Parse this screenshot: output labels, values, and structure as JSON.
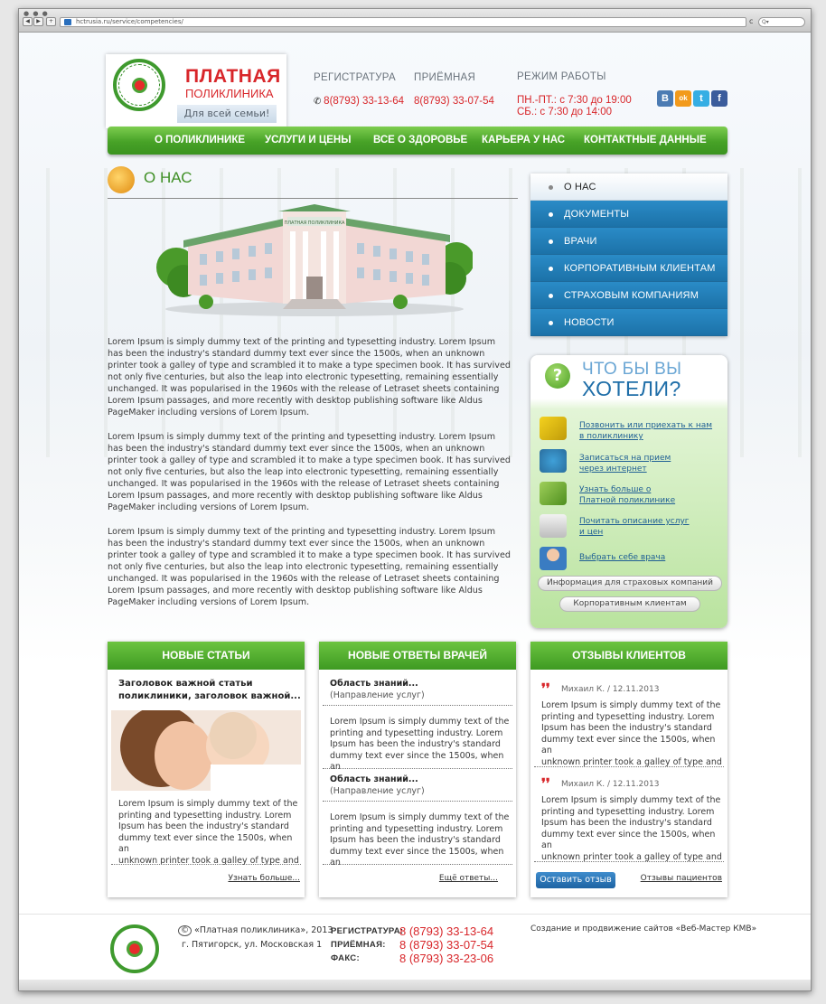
{
  "browser": {
    "url": "hctrusia.ru/service/competencies/"
  },
  "header": {
    "logo_title": "ПЛАТНАЯ",
    "logo_subtitle": "ПОЛИКЛИНИКА",
    "slogan": "Для всей семьи!",
    "reg_label": "РЕГИСТРАТУРА",
    "reg_phone": "8(8793) 33-13-64",
    "reception_label": "ПРИЁМНАЯ",
    "reception_phone": "8(8793) 33-07-54",
    "hours_label": "РЕЖИМ РАБОТЫ",
    "hours_weekday": "ПН.-ПТ.: с 7:30 до 19:00",
    "hours_saturday": "СБ.: с 7:30 до 14:00",
    "social": [
      "В",
      "ok",
      "t",
      "f"
    ]
  },
  "menu": [
    "О ПОЛИКЛИНИКЕ",
    "УСЛУГИ И ЦЕНЫ",
    "ВСЕ О ЗДОРОВЬЕ",
    "КАРЬЕРА У НАС",
    "КОНТАКТНЫЕ ДАННЫЕ"
  ],
  "main": {
    "title": "О НАС",
    "building_sign": "ПЛАТНАЯ ПОЛИКЛИНИКА",
    "paragraphs": [
      "Lorem Ipsum is simply dummy text of the printing and typesetting industry. Lorem Ipsum has been the industry's standard dummy text ever since the 1500s, when an unknown printer took a galley of type and scrambled it to make a type specimen book. It has survived not only five centuries, but also the leap into electronic typesetting, remaining essentially unchanged. It was popularised in the 1960s with the release of Letraset sheets containing Lorem Ipsum passages, and more recently with desktop publishing software like Aldus PageMaker including versions of Lorem Ipsum.",
      "Lorem Ipsum is simply dummy text of the printing and typesetting industry. Lorem Ipsum has been the industry's standard dummy text ever since the 1500s, when an unknown printer took a galley of type and scrambled it to make a type specimen book. It has survived not only five centuries, but also the leap into electronic typesetting, remaining essentially unchanged. It was popularised in the 1960s with the release of Letraset sheets containing Lorem Ipsum passages, and more recently with desktop publishing software like Aldus PageMaker including versions of Lorem Ipsum.",
      "Lorem Ipsum is simply dummy text of the printing and typesetting industry. Lorem Ipsum has been the industry's standard dummy text ever since the 1500s, when an unknown printer took a galley of type and scrambled it to make a type specimen book. It has survived not only five centuries, but also the leap into electronic typesetting, remaining essentially unchanged. It was popularised in the 1960s with the release of Letraset sheets containing Lorem Ipsum passages, and more recently with desktop publishing software like Aldus PageMaker including versions of Lorem Ipsum."
    ]
  },
  "sidebar": {
    "items": [
      "О НАС",
      "ДОКУМЕНТЫ",
      "ВРАЧИ",
      "КОРПОРАТИВНЫМ КЛИЕНТАМ",
      "СТРАХОВЫМ КОМПАНИЯМ",
      "НОВОСТИ"
    ]
  },
  "want": {
    "title1": "ЧТО БЫ ВЫ",
    "title2": "ХОТЕЛИ?",
    "links": [
      [
        "Позвонить или приехать к нам",
        "в поликлинику"
      ],
      [
        "Записаться на прием",
        "через интернет"
      ],
      [
        "Узнать больше о",
        "Платной поликлинике"
      ],
      [
        "Почитать описание услуг",
        "и цен"
      ],
      [
        "Выбрать себе врача"
      ]
    ],
    "btn_insurance": "Информация для страховых компаний",
    "btn_corporate": "Корпоративным клиентам"
  },
  "articles": {
    "title": "НОВЫЕ СТАТЬИ",
    "headline_1": "Заголовок важной статьи",
    "headline_2": "поликлиники, заголовок важной...",
    "text": [
      "Lorem Ipsum is simply dummy text of the",
      "printing and typesetting industry. Lorem",
      "Ipsum has been the industry's standard",
      "dummy text ever since the 1500s, when an",
      "unknown printer took a galley of type and"
    ],
    "more": "Узнать больше..."
  },
  "answers": {
    "title": "НОВЫЕ ОТВЕТЫ ВРАЧЕЙ",
    "item_title": "Область знаний...",
    "item_sub": "(Направление услуг)",
    "text": [
      "Lorem Ipsum is simply dummy text of the",
      "printing and typesetting industry. Lorem",
      "Ipsum has been the industry's standard",
      "dummy text ever since the 1500s, when an"
    ],
    "more": "Ещё ответы..."
  },
  "reviews": {
    "title": "ОТЗЫВЫ КЛИЕНТОВ",
    "author": "Михаил К. / 12.11.2013",
    "text": [
      "Lorem Ipsum is simply dummy text of the",
      "printing and typesetting industry. Lorem",
      "Ipsum has been the industry's standard",
      "dummy text ever since the 1500s, when an",
      "unknown printer took a galley of type and"
    ],
    "btn": "Оставить отзыв",
    "link": "Отзывы пациентов"
  },
  "footer": {
    "copyright": "«Платная поликлиника», 2013",
    "copyright_symbol": "©",
    "address": "г. Пятигорск, ул. Московская 1",
    "reg_label": "РЕГИСТРАТУРА:",
    "reg_phone": "8 (8793) 33-13-64",
    "reception_label": "ПРИЁМНАЯ:",
    "reception_phone": "8 (8793) 33-07-54",
    "fax_label": "ФАКС:",
    "fax_phone": "8 (8793) 33-23-06",
    "credits": "Создание и продвижение сайтов «Веб-Мастер КМВ»"
  }
}
